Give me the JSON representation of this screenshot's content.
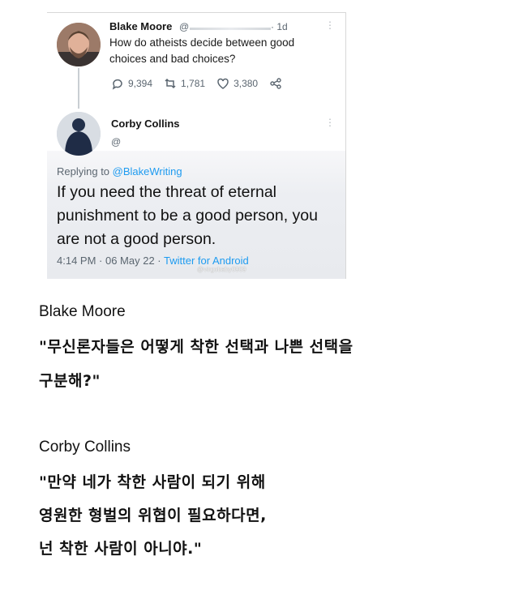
{
  "tweet": {
    "author": {
      "name": "Blake Moore",
      "handle": "@",
      "time": "· 1d",
      "text": "How do atheists decide between good choices and bad choices?"
    },
    "actions": {
      "replies": "9,394",
      "retweets": "1,781",
      "likes": "3,380"
    },
    "more_glyph": "⋮"
  },
  "reply": {
    "author": {
      "name": "Corby Collins",
      "handle": "@"
    },
    "replying_to_label": "Replying to",
    "replying_to_handle": "@BlakeWriting",
    "text": "If you need the threat of eternal punishment to be a good person, you are not a good person.",
    "timestamp": "4:14 PM · 06 May 22 · ",
    "source": "Twitter for Android",
    "watermark": "@virgobaby0909"
  },
  "translation": {
    "first": {
      "name": "Blake Moore",
      "lines": [
        "\"무신론자들은 어떻게 착한 선택과 나쁜 선택을",
        "구분해?\""
      ]
    },
    "second": {
      "name": "Corby Collins",
      "lines": [
        "\"만약 네가 착한 사람이 되기 위해",
        "영원한 형벌의 위협이 필요하다면,",
        "넌 착한 사람이 아니야.\""
      ]
    }
  },
  "colors": {
    "link": "#1d9bf0",
    "muted": "#5b6670"
  }
}
